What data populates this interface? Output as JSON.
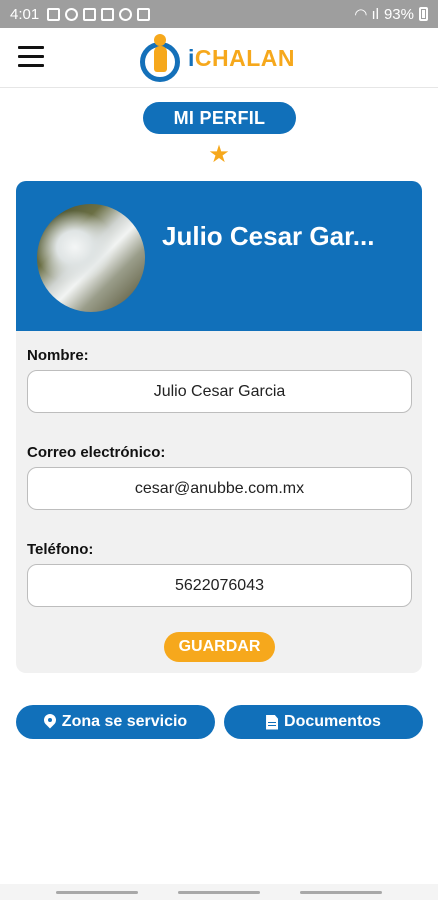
{
  "status_bar": {
    "time": "4:01",
    "battery": "93%"
  },
  "app": {
    "logo_text_i": "i",
    "logo_text_rest": "CHALAN"
  },
  "page": {
    "title": "MI PERFIL"
  },
  "profile": {
    "name": "Julio Cesar Gar..."
  },
  "form": {
    "name_label": "Nombre:",
    "name_value": "Julio Cesar Garcia",
    "email_label": "Correo electrónico:",
    "email_value": "cesar@anubbe.com.mx",
    "phone_label": "Teléfono:",
    "phone_value": "5622076043",
    "save_label": "GUARDAR"
  },
  "actions": {
    "zona_label": "Zona se servicio",
    "docs_label": "Documentos"
  },
  "colors": {
    "primary": "#1170ba",
    "accent": "#f6a81c",
    "card_bg": "#f1f1f1"
  },
  "icons": {
    "menu": "hamburger-icon",
    "star": "star-icon",
    "zona": "map-pin-icon",
    "docs": "document-icon"
  }
}
